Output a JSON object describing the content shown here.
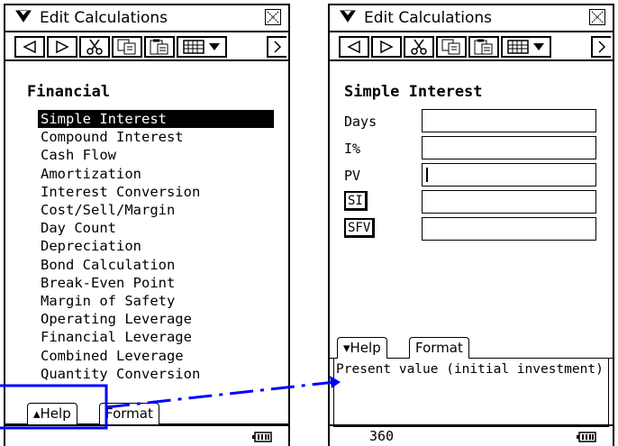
{
  "left_window": {
    "menu_title": "Edit Calculations",
    "panel_title": "Financial",
    "list_items": [
      "Simple Interest",
      "Compound Interest",
      "Cash Flow",
      "Amortization",
      "Interest Conversion",
      "Cost/Sell/Margin",
      "Day Count",
      "Depreciation",
      "Bond Calculation",
      "Break-Even Point",
      "Margin of Safety",
      "Operating Leverage",
      "Financial Leverage",
      "Combined Leverage",
      "Quantity Conversion"
    ],
    "selected_item": "Simple Interest",
    "tabs": {
      "help": "▴Help",
      "format": "Format"
    }
  },
  "right_window": {
    "menu_title": "Edit Calculations",
    "panel_title": "Simple Interest",
    "fields": [
      {
        "label": "Days",
        "value": ""
      },
      {
        "label": "I%",
        "value": ""
      },
      {
        "label": "PV",
        "value": ""
      }
    ],
    "buttons": [
      {
        "label": "SI",
        "value": ""
      },
      {
        "label": "SFV",
        "value": ""
      }
    ],
    "active_field": "PV",
    "tabs": {
      "help": "▾Help",
      "format": "Format"
    },
    "help_text": "Present value (initial investment)",
    "status_value": "360"
  },
  "colors": {
    "annotation": "#0000ff",
    "selection": "#000000"
  }
}
